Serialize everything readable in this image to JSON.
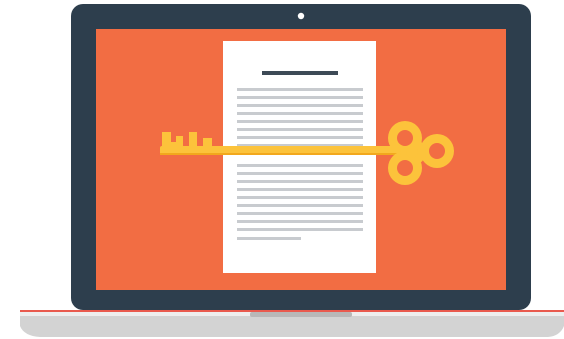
{
  "colors": {
    "background": "#ffffff",
    "bezel": "#2d3e4d",
    "screen": "#f26d43",
    "paper": "#ffffff",
    "paper_heading": "#3d4a56",
    "paper_lines": "#c8cbcf",
    "key": "#fcc33b",
    "key_shadow": "#f2a81d",
    "camera": "#ffffff",
    "base": "#d3d3d3",
    "base_highlight": "#eeeeee",
    "base_edge": "#e95a4e",
    "trackpad_notch": "#b8b8b8"
  },
  "icons": {
    "device": "laptop-icon",
    "document": "document-icon",
    "key": "key-icon"
  }
}
